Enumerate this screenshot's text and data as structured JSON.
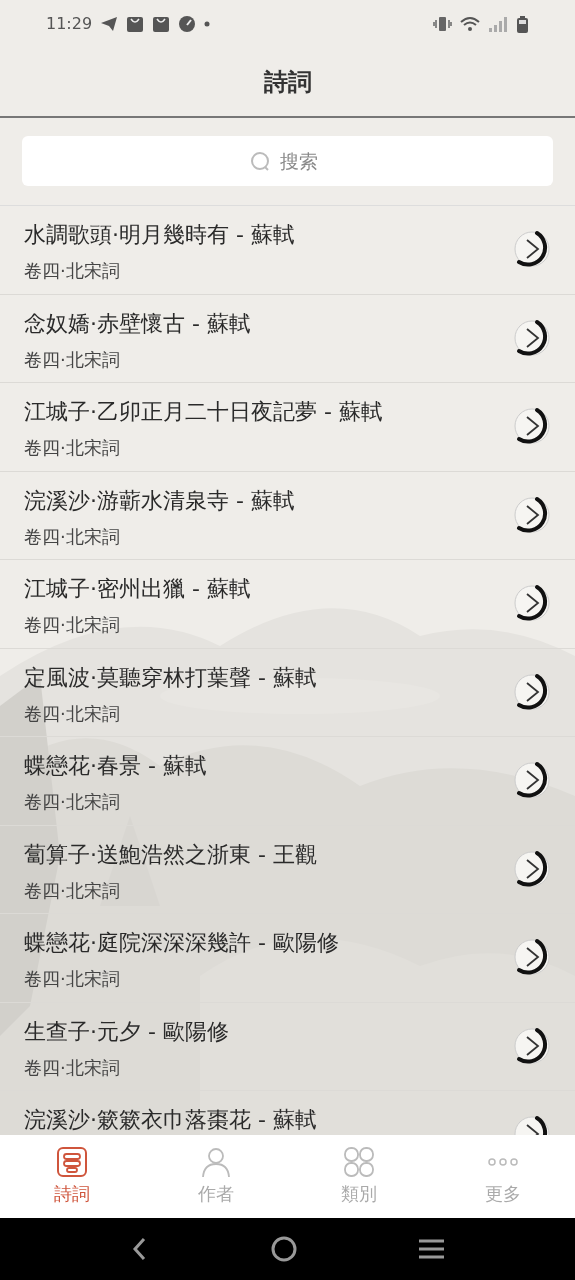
{
  "status_bar": {
    "time": "11:29"
  },
  "header": {
    "title": "詩詞"
  },
  "search": {
    "placeholder": "搜索"
  },
  "poems": [
    {
      "title": "水調歌頭·明月幾時有 - 蘇軾",
      "subtitle": "卷四·北宋詞"
    },
    {
      "title": "念奴嬌·赤壁懷古 - 蘇軾",
      "subtitle": "卷四·北宋詞"
    },
    {
      "title": "江城子·乙卯正月二十日夜記夢 - 蘇軾",
      "subtitle": "卷四·北宋詞"
    },
    {
      "title": "浣溪沙·游蘄水清泉寺 - 蘇軾",
      "subtitle": "卷四·北宋詞"
    },
    {
      "title": "江城子·密州出獵 - 蘇軾",
      "subtitle": "卷四·北宋詞"
    },
    {
      "title": "定風波·莫聽穿林打葉聲 - 蘇軾",
      "subtitle": "卷四·北宋詞"
    },
    {
      "title": "蝶戀花·春景 - 蘇軾",
      "subtitle": "卷四·北宋詞"
    },
    {
      "title": "蔔算子·送鮑浩然之浙東 - 王觀",
      "subtitle": "卷四·北宋詞"
    },
    {
      "title": "蝶戀花·庭院深深深幾許 - 歐陽修",
      "subtitle": "卷四·北宋詞"
    },
    {
      "title": "生查子·元夕 - 歐陽修",
      "subtitle": "卷四·北宋詞"
    },
    {
      "title": "浣溪沙·簌簌衣巾落棗花 - 蘇軾"
    }
  ],
  "tabs": [
    {
      "kind": "poems",
      "label": "詩詞",
      "selected": true
    },
    {
      "kind": "authors",
      "label": "作者",
      "selected": false
    },
    {
      "kind": "categories",
      "label": "類別",
      "selected": false
    },
    {
      "kind": "more",
      "label": "更多",
      "selected": false
    }
  ]
}
